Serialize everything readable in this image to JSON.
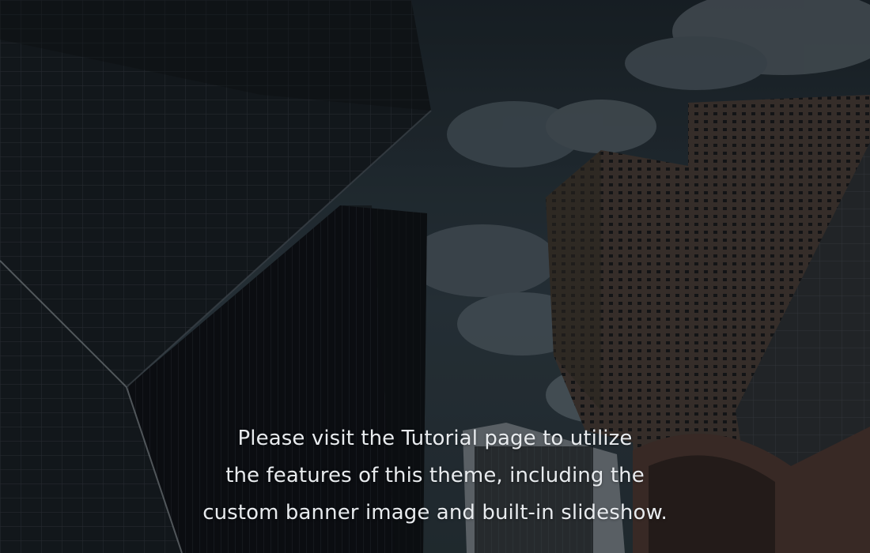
{
  "banner": {
    "caption_lines": [
      "Please visit the Tutorial page to utilize",
      "the features of this theme, including the",
      "custom banner image and built-in slideshow."
    ]
  },
  "colors": {
    "sky": "#2b3740",
    "cloud": "#6f7b84",
    "building_dark": "#14191e",
    "building_mid": "#2a3137",
    "building_brick": "#4a3d37",
    "text": "#e8ebee"
  }
}
